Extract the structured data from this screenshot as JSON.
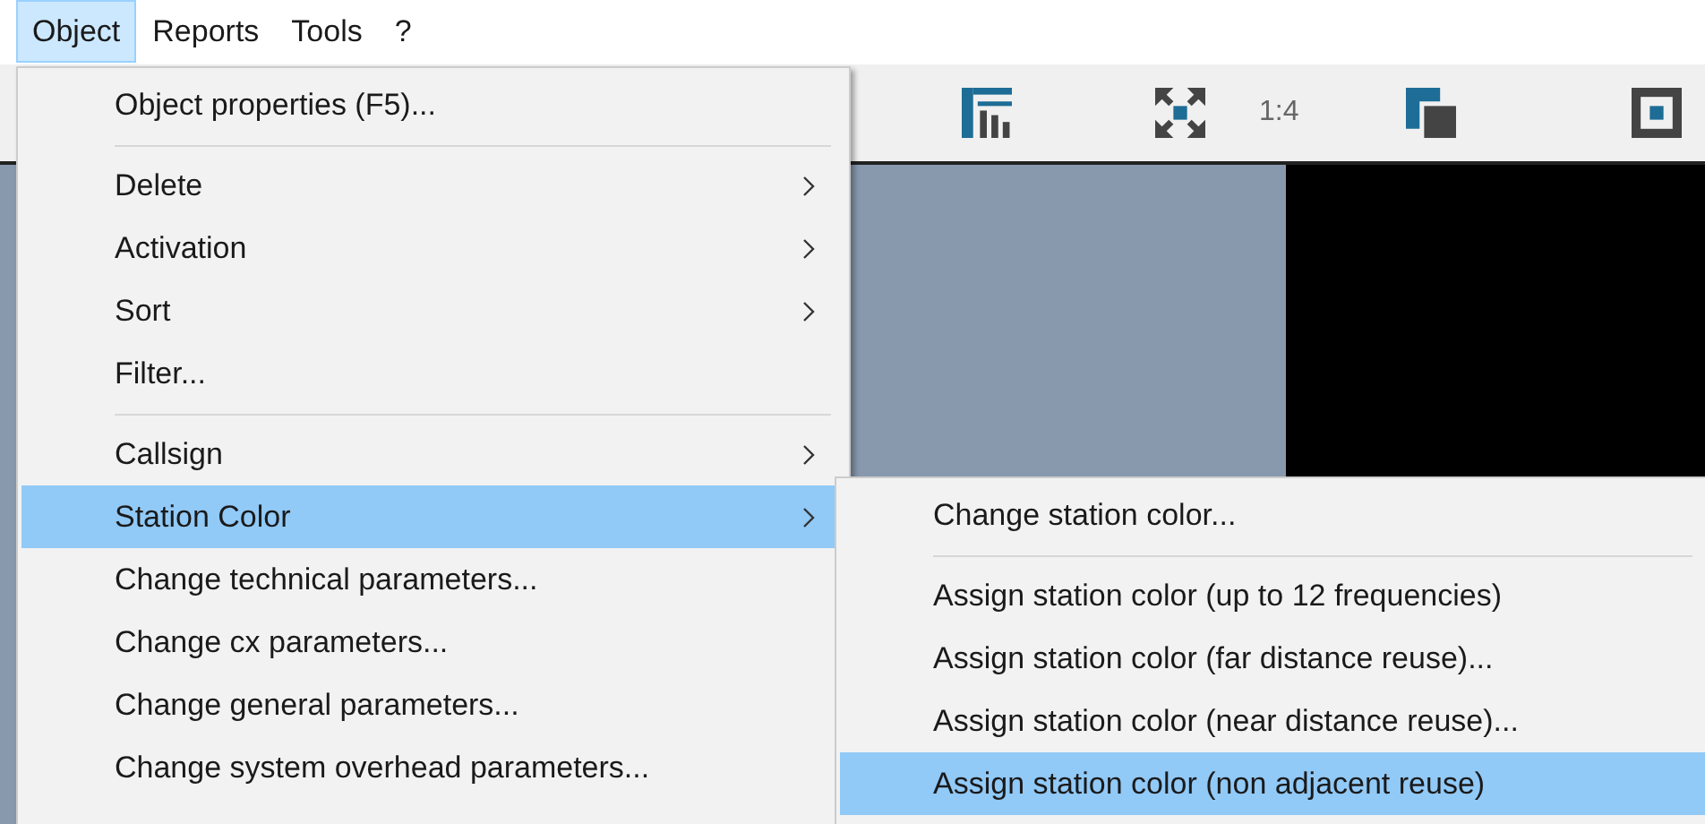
{
  "menubar": [
    {
      "label": "Object",
      "selected": true
    },
    {
      "label": "Reports",
      "selected": false
    },
    {
      "label": "Tools",
      "selected": false
    },
    {
      "label": "?",
      "selected": false
    }
  ],
  "toolbar": {
    "zoom_label": "1:4"
  },
  "menu": {
    "items": [
      {
        "kind": "item",
        "label": "Object properties (F5)...",
        "submenu": false,
        "selected": false
      },
      {
        "kind": "separator"
      },
      {
        "kind": "item",
        "label": "Delete",
        "submenu": true,
        "selected": false
      },
      {
        "kind": "item",
        "label": "Activation",
        "submenu": true,
        "selected": false
      },
      {
        "kind": "item",
        "label": "Sort",
        "submenu": true,
        "selected": false
      },
      {
        "kind": "item",
        "label": "Filter...",
        "submenu": false,
        "selected": false
      },
      {
        "kind": "separator"
      },
      {
        "kind": "item",
        "label": "Callsign",
        "submenu": true,
        "selected": false
      },
      {
        "kind": "item",
        "label": "Station Color",
        "submenu": true,
        "selected": true
      },
      {
        "kind": "item",
        "label": "Change technical parameters...",
        "submenu": false,
        "selected": false
      },
      {
        "kind": "item",
        "label": "Change cx parameters...",
        "submenu": false,
        "selected": false
      },
      {
        "kind": "item",
        "label": "Change general parameters...",
        "submenu": false,
        "selected": false
      },
      {
        "kind": "item",
        "label": "Change system overhead parameters...",
        "submenu": false,
        "selected": false
      }
    ]
  },
  "submenu": {
    "items": [
      {
        "kind": "item",
        "label": "Change station color...",
        "selected": false
      },
      {
        "kind": "separator"
      },
      {
        "kind": "item",
        "label": "Assign station color (up to 12 frequencies)",
        "selected": false
      },
      {
        "kind": "item",
        "label": "Assign station color (far distance reuse)...",
        "selected": false
      },
      {
        "kind": "item",
        "label": "Assign station color (near distance reuse)...",
        "selected": false
      },
      {
        "kind": "item",
        "label": "Assign station color (non adjacent reuse)",
        "selected": true
      }
    ]
  }
}
